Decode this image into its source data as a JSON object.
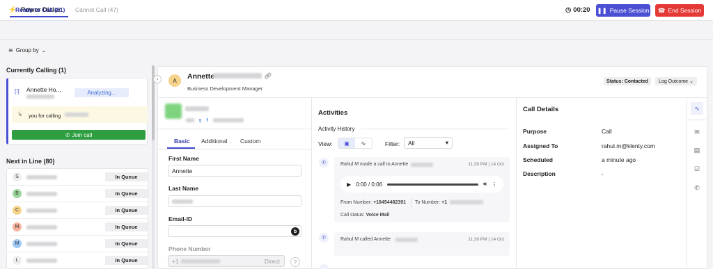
{
  "header": {
    "title": "Power Dialer",
    "timer": "00:20",
    "pause_label": "Pause Session",
    "end_label": "End Session",
    "accent": "#4a4fd4",
    "danger": "#e53935"
  },
  "tabs": [
    {
      "label": "Ready to Call (81)"
    },
    {
      "label": "Cannot Call (47)"
    }
  ],
  "group_by": "Group by",
  "currently_calling": {
    "heading": "Currently Calling (1)",
    "name": "Annette Ho...",
    "status": "Analyzing...",
    "calling_note": "you for calling",
    "join_label": "Join call"
  },
  "next_in_line": {
    "heading": "Next in Line (80)",
    "rows": [
      {
        "initial": "S",
        "color": "#eeeeee",
        "badge": "In Queue"
      },
      {
        "initial": "B",
        "color": "#9ed79e",
        "badge": "In Queue"
      },
      {
        "initial": "C",
        "color": "#f6d38b",
        "badge": "In Queue"
      },
      {
        "initial": "M",
        "color": "#f6b39b",
        "badge": "In Queue"
      },
      {
        "initial": "M",
        "color": "#9ec9f6",
        "badge": "In Queue"
      },
      {
        "initial": "L",
        "color": "#eeeeee",
        "badge": "In Queue"
      }
    ]
  },
  "contact": {
    "initial": "A",
    "first_name_display": "Annette",
    "job_title": "Business Development Manager",
    "status": "Status: Contacted",
    "log_outcome": "Log Outcome"
  },
  "form": {
    "tabs": [
      "Basic",
      "Additional",
      "Custom"
    ],
    "first_name_label": "First Name",
    "first_name_value": "Annette",
    "last_name_label": "Last Name",
    "email_label": "Email-ID",
    "phone_label": "Phone Number",
    "phone_prefix": "+1",
    "phone_type": "Direct"
  },
  "activities": {
    "title": "Activities",
    "history_label": "Activity History",
    "view_label": "View:",
    "filter_label": "Filter:",
    "filter_value": "All",
    "items": [
      {
        "text": "Rahul M made a call to Annette",
        "time": "11:26 PM | 14 Oct",
        "player_time": "0:00 / 0:06",
        "from_label": "From Number:",
        "from_value": "+18454482391",
        "to_label": "To Number:",
        "to_value": "+1",
        "status_label": "Call status:",
        "status_value": "Voice Mail"
      },
      {
        "text": "Rahul M called Annette",
        "time": "11:26 PM | 14 Oct"
      }
    ]
  },
  "call_details": {
    "title": "Call Details",
    "rows": [
      {
        "key": "Purpose",
        "value": "Call"
      },
      {
        "key": "Assigned To",
        "value": "rahul.m@klenty.com"
      },
      {
        "key": "Scheduled",
        "value": "a minute ago"
      },
      {
        "key": "Description",
        "value": "-"
      }
    ]
  }
}
